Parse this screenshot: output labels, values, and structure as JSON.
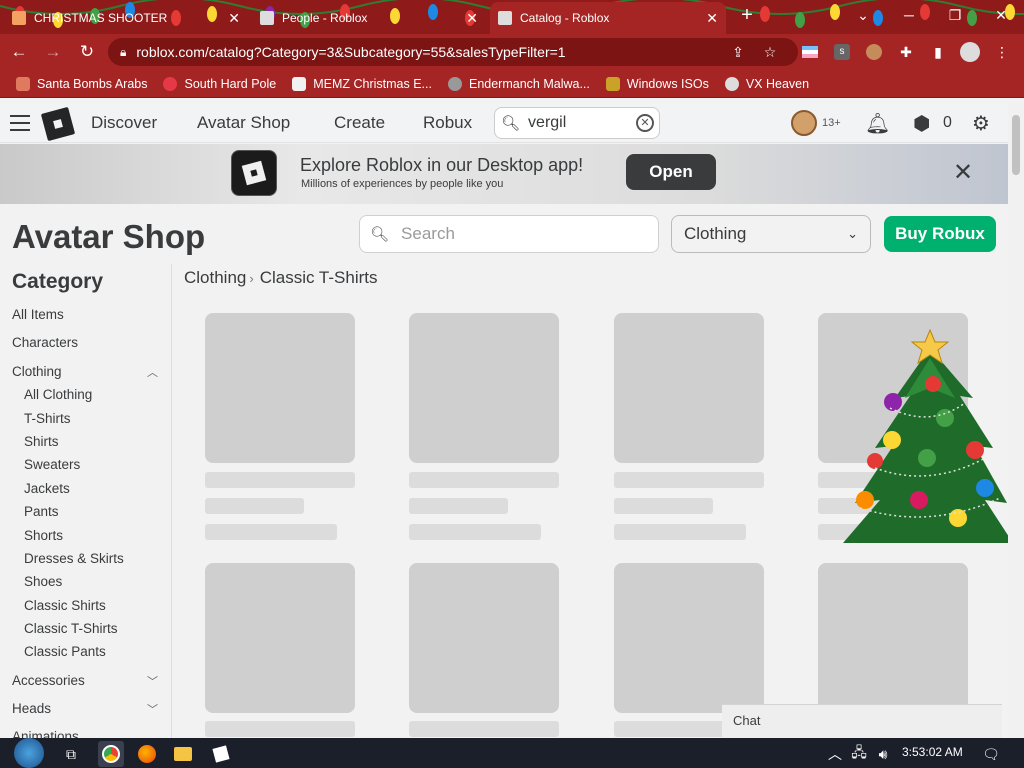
{
  "browser": {
    "tabs": [
      {
        "title": "CHRISTMAS SHOOTER",
        "active": false
      },
      {
        "title": "People - Roblox",
        "active": false
      },
      {
        "title": "Catalog - Roblox",
        "active": true
      }
    ],
    "url": "roblox.com/catalog?Category=3&Subcategory=55&salesTypeFilter=1",
    "bookmarks": [
      "Santa Bombs Arabs",
      "South Hard Pole",
      "MEMZ Christmas E...",
      "Endermanch Malwa...",
      "Windows ISOs",
      "VX Heaven"
    ]
  },
  "header": {
    "nav": [
      "Discover",
      "Avatar Shop",
      "Create",
      "Robux"
    ],
    "search_value": "vergil",
    "age_label": "13+",
    "robux_count": "0"
  },
  "banner": {
    "title": "Explore Roblox in our Desktop app!",
    "subtitle": "Millions of experiences by people like you",
    "open_label": "Open"
  },
  "page": {
    "title": "Avatar Shop",
    "search_placeholder": "Search",
    "category_select": "Clothing",
    "buy_robux": "Buy Robux"
  },
  "sidebar": {
    "heading": "Category",
    "top_items": [
      "All Items",
      "Characters",
      "Clothing"
    ],
    "clothing_sub": [
      "All Clothing",
      "T-Shirts",
      "Shirts",
      "Sweaters",
      "Jackets",
      "Pants",
      "Shorts",
      "Dresses & Skirts",
      "Shoes",
      "Classic Shirts",
      "Classic T-Shirts",
      "Classic Pants"
    ],
    "bottom_items": [
      "Accessories",
      "Heads",
      "Animations"
    ]
  },
  "breadcrumb": {
    "parent": "Clothing",
    "current": "Classic T-Shirts"
  },
  "chat_label": "Chat",
  "taskbar": {
    "time": "3:53:02 AM"
  },
  "colors": {
    "chrome_red": "#a52424",
    "buy_green": "#00b06f",
    "skeleton": "#cfcfcf"
  }
}
